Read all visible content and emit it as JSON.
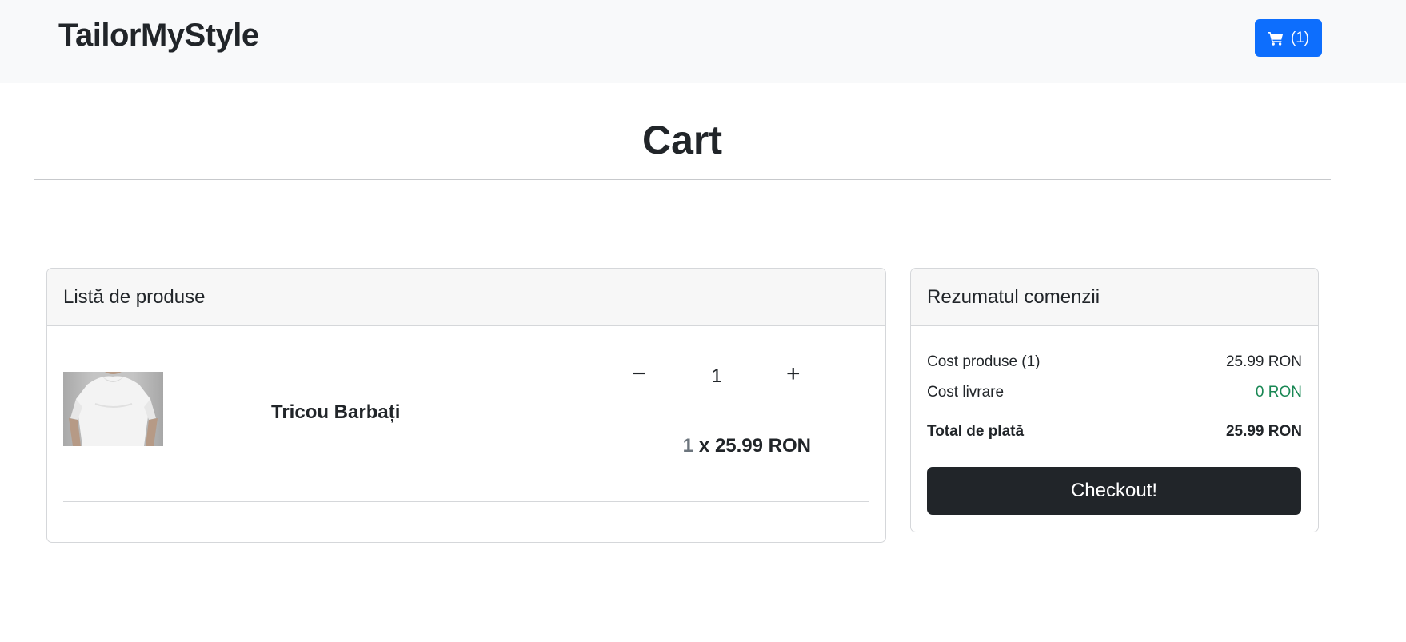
{
  "header": {
    "brand": "TailorMyStyle",
    "cart_count": "(1)",
    "cart_icon": "shopping-cart-icon"
  },
  "page": {
    "title": "Cart"
  },
  "products_panel": {
    "title": "Listă de produse",
    "items": [
      {
        "image": "white-t-shirt-photo",
        "name": "Tricou Barbați",
        "quantity": "1",
        "minus_label": "−",
        "plus_label": "+",
        "line_qty": "1",
        "line_price": "x 25.99 RON"
      }
    ]
  },
  "summary_panel": {
    "title": "Rezumatul comenzii",
    "products_cost_label": "Cost produse (1)",
    "products_cost_value": "25.99 RON",
    "delivery_label": "Cost livrare",
    "delivery_value": "0 RON",
    "total_label": "Total de plată",
    "total_value": "25.99 RON",
    "checkout_label": "Checkout!"
  },
  "colors": {
    "nav_bg": "#f8f9fa",
    "primary": "#0d6efd",
    "dark": "#212529",
    "success": "#198754"
  }
}
